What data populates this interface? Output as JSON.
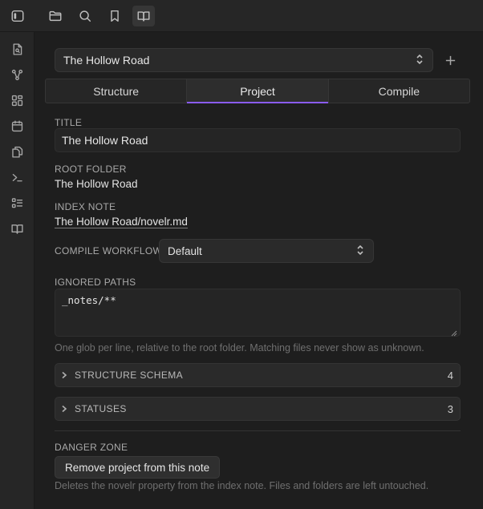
{
  "topbar": {
    "icons": [
      "sidebar-toggle-icon",
      "folder-icon",
      "search-icon",
      "bookmark-icon",
      "book-open-icon"
    ],
    "active": "book-open-icon"
  },
  "ribbon": {
    "icons": [
      "file-search-icon",
      "graph-icon",
      "grid-icon",
      "calendar-icon",
      "copy-icon",
      "terminal-icon",
      "list-checks-icon",
      "book-icon"
    ]
  },
  "project": {
    "selected": "The Hollow Road"
  },
  "tabs": [
    {
      "label": "Structure"
    },
    {
      "label": "Project"
    },
    {
      "label": "Compile"
    }
  ],
  "active_tab": "Project",
  "fields": {
    "title_label": "TITLE",
    "title_value": "The Hollow Road",
    "root_folder_label": "ROOT FOLDER",
    "root_folder_value": "The Hollow Road",
    "index_note_label": "INDEX NOTE",
    "index_note_value": "The Hollow Road/novelr.md",
    "compile_workflow_label": "COMPILE WORKFLOW",
    "compile_workflow_value": "Default",
    "ignored_paths_label": "IGNORED PATHS",
    "ignored_paths_value": "_notes/**",
    "ignored_paths_hint": "One glob per line, relative to the root folder. Matching files never show as unknown."
  },
  "sections": [
    {
      "title": "STRUCTURE SCHEMA",
      "count": "4"
    },
    {
      "title": "STATUSES",
      "count": "3"
    }
  ],
  "danger": {
    "label": "DANGER ZONE",
    "button": "Remove project from this note",
    "hint": "Deletes the novelr property from the index note. Files and folders are left untouched."
  },
  "colors": {
    "accent": "#8a5cf5",
    "background": "#1e1e1e",
    "panel": "#262626"
  }
}
